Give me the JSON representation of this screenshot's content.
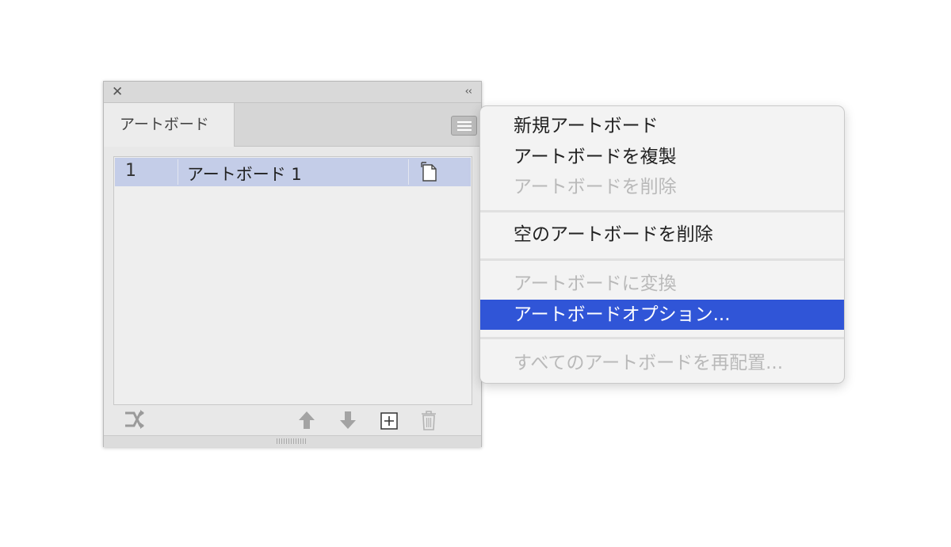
{
  "panel": {
    "close_glyph": "✕",
    "collapse_glyph": "‹‹",
    "tab_label": "アートボード",
    "rows": [
      {
        "number": "1",
        "name": "アートボード 1"
      }
    ],
    "footer_icons": [
      "rearrange-icon",
      "move-up-icon",
      "move-down-icon",
      "new-artboard-icon",
      "trash-icon"
    ]
  },
  "menu": {
    "items": [
      {
        "label": "新規アートボード",
        "state": "enabled"
      },
      {
        "label": "アートボードを複製",
        "state": "enabled"
      },
      {
        "label": "アートボードを削除",
        "state": "disabled"
      },
      {
        "label": "空のアートボードを削除",
        "state": "enabled"
      },
      {
        "label": "アートボードに変換",
        "state": "disabled"
      },
      {
        "label": "アートボードオプション...",
        "state": "highlighted"
      },
      {
        "label": "すべてのアートボードを再配置...",
        "state": "disabled"
      }
    ]
  },
  "colors": {
    "highlight": "#3055d7",
    "selected_row": "#c4cde8",
    "disabled_text": "#b9b9b9"
  }
}
